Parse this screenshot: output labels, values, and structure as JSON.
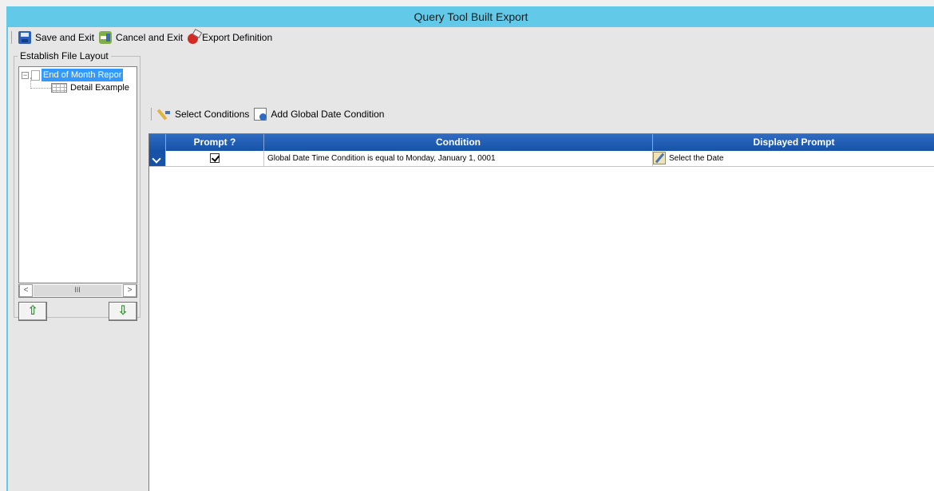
{
  "window": {
    "title": "Query Tool Built Export"
  },
  "toolbar": {
    "save_label": "Save and Exit",
    "cancel_label": "Cancel and Exit",
    "export_label": "Export Definition"
  },
  "layout": {
    "group_label": "Establish File Layout",
    "tree": {
      "root_label": "End of Month Repor",
      "child_label": "Detail Example"
    },
    "scrollbar": {
      "left": "<",
      "thumb": "III",
      "right": ">"
    },
    "move_up_label": "⇧",
    "move_down_label": "⇩"
  },
  "conditions_toolbar": {
    "select_label": "Select Conditions",
    "add_global_label": "Add Global Date Condition"
  },
  "grid": {
    "columns": [
      "Prompt ?",
      "Condition",
      "Displayed Prompt"
    ],
    "rows": [
      {
        "prompt_checked": true,
        "condition": "Global Date Time Condition is equal to Monday, January 1, 0001",
        "displayed_prompt": "Select the Date"
      }
    ]
  },
  "colors": {
    "title_bar": "#62c9e8",
    "grid_header": "#1552a8",
    "tree_selection": "#3399ff"
  }
}
